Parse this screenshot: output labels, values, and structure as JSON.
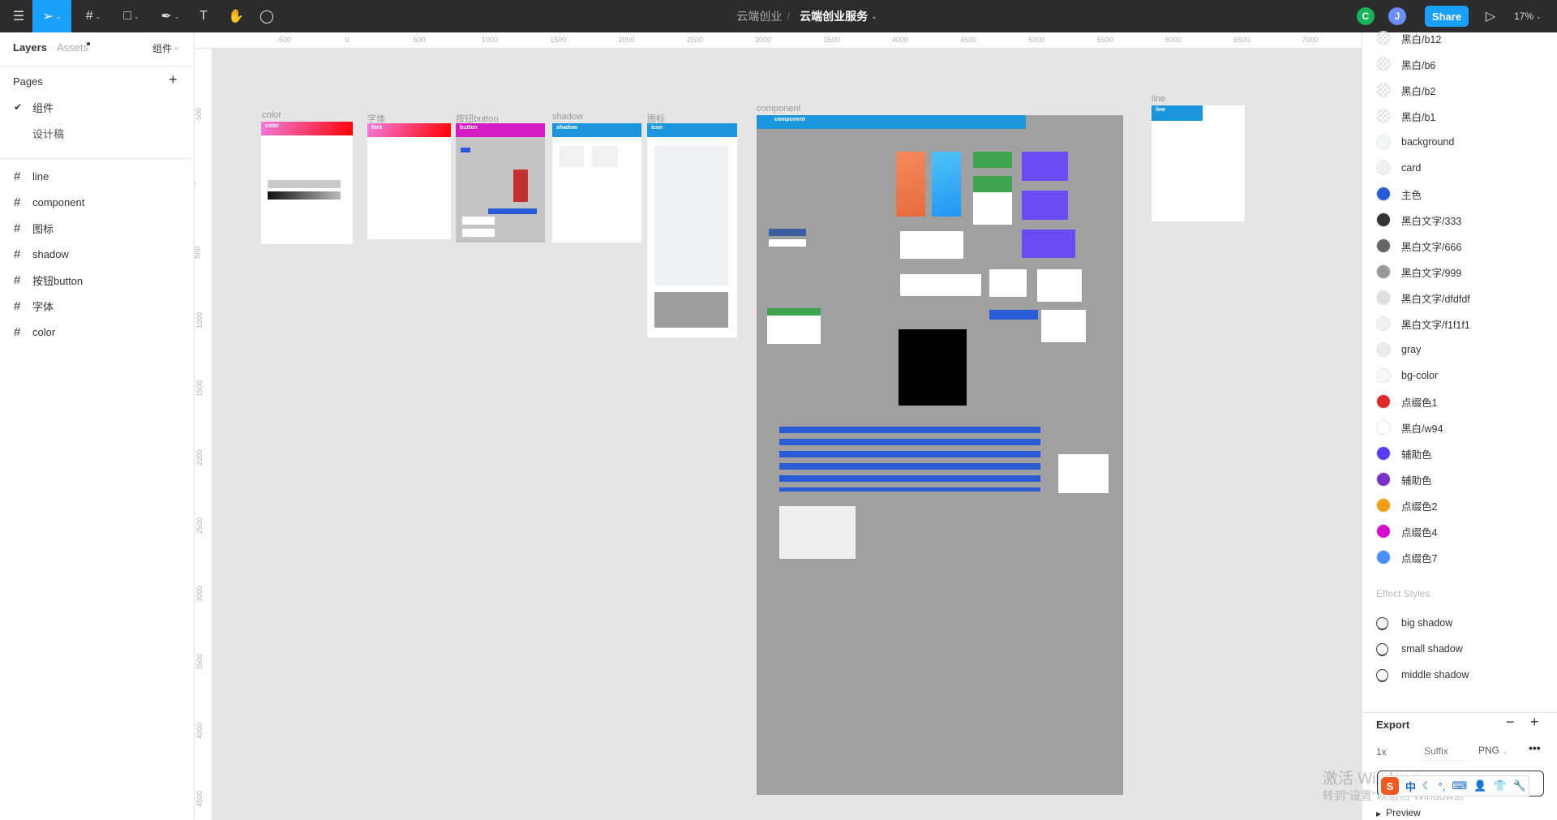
{
  "toolbar": {
    "tools": [
      "menu-icon",
      "move-icon",
      "frame-icon",
      "rectangle-icon",
      "pen-icon",
      "text-icon",
      "hand-icon",
      "comment-icon"
    ],
    "project": "云端创业",
    "separator": "/",
    "file": "云端创业服务",
    "avatars": [
      {
        "letter": "C",
        "color": "#1bb35a"
      },
      {
        "letter": "J",
        "color": "#6b8ef5"
      }
    ],
    "share": "Share",
    "zoom": "17%"
  },
  "left": {
    "tabs": {
      "layers": "Layers",
      "assets": "Assets",
      "page_select": "组件"
    },
    "pages_title": "Pages",
    "pages": [
      {
        "label": "组件",
        "selected": true
      },
      {
        "label": "设计稿",
        "selected": false
      }
    ],
    "layers": [
      "line",
      "component",
      "图标",
      "shadow",
      "按钮button",
      "字体",
      "color"
    ]
  },
  "rulers": {
    "h": [
      "-500",
      "0",
      "500",
      "1000",
      "1500",
      "2000",
      "2500",
      "3000",
      "3500",
      "4000",
      "4500",
      "5000",
      "5500",
      "6000",
      "6500",
      "7000"
    ],
    "v": [
      "-500",
      "0",
      "500",
      "1000",
      "1500",
      "2000",
      "2500",
      "3000",
      "3500",
      "4000",
      "4500"
    ]
  },
  "canvas": {
    "frames": {
      "color": {
        "label": "color",
        "header": "color"
      },
      "font": {
        "label": "字体",
        "header": "font"
      },
      "button": {
        "label": "按钮button",
        "header": "button"
      },
      "shadow": {
        "label": "shadow",
        "header": "shadow"
      },
      "icon": {
        "label": "图标",
        "header": "icon"
      },
      "component": {
        "label": "component",
        "header": "component"
      },
      "line": {
        "label": "line",
        "header": "line"
      }
    }
  },
  "right": {
    "colors": [
      {
        "name": "黑白/b12",
        "hex": "#e0e0e0"
      },
      {
        "name": "黑白/b6",
        "hex": "#ececec"
      },
      {
        "name": "黑白/b2",
        "hex": "#f6f6f6"
      },
      {
        "name": "黑白/b1",
        "hex": "#fafafa"
      },
      {
        "name": "background",
        "hex": "#f5f6fa"
      },
      {
        "name": "card",
        "hex": "#f1f1f1"
      },
      {
        "name": "主色",
        "hex": "#2a5bd7"
      },
      {
        "name": "黑白文字/333",
        "hex": "#333333"
      },
      {
        "name": "黑白文字/666",
        "hex": "#666666"
      },
      {
        "name": "黑白文字/999",
        "hex": "#999999"
      },
      {
        "name": "黑白文字/dfdfdf",
        "hex": "#dfdfdf"
      },
      {
        "name": "黑白文字/f1f1f1",
        "hex": "#f1f1f1"
      },
      {
        "name": "gray",
        "hex": "#ececec"
      },
      {
        "name": "bg-color",
        "hex": "#f8f8f8"
      },
      {
        "name": "点缀色1",
        "hex": "#e02a2a"
      },
      {
        "name": "黑白/w94",
        "hex": "#ffffff"
      },
      {
        "name": "辅助色",
        "hex": "#5b3cf5"
      },
      {
        "name": "辅助色",
        "hex": "#7b30c9"
      },
      {
        "name": "点缀色2",
        "hex": "#f29d12"
      },
      {
        "name": "点缀色4",
        "hex": "#d50fc9"
      },
      {
        "name": "点缀色7",
        "hex": "#4a8ef8"
      }
    ],
    "effect_title": "Effect Styles",
    "effects": [
      "big shadow",
      "small shadow",
      "middle shadow"
    ],
    "export": {
      "title": "Export",
      "scale": "1x",
      "suffix_placeholder": "Suffix",
      "format": "PNG",
      "preview": "Preview"
    }
  },
  "overlay": {
    "watermark_line1": "激活 Windows",
    "watermark_line2": "转到\"设置\"以激活 Windows。",
    "ime": "中"
  }
}
